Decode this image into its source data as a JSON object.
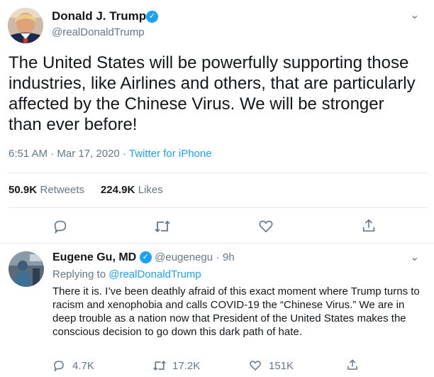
{
  "tweet": {
    "author_name": "Donald J. Trump",
    "author_handle": "@realDonaldTrump",
    "text": "The United States will be powerfully supporting those industries, like Airlines and others, that are particularly affected by the Chinese Virus. We will be stronger than ever before!",
    "time": "6:51 AM",
    "date": "Mar 17, 2020",
    "source": "Twitter for iPhone",
    "retweets_count": "50.9K",
    "retweets_label": "Retweets",
    "likes_count": "224.9K",
    "likes_label": "Likes",
    "icons": [
      "reply-icon",
      "retweet-icon",
      "like-icon",
      "share-icon"
    ]
  },
  "reply": {
    "author_name": "Eugene Gu, MD",
    "author_handle": "@eugenegu",
    "age": "9h",
    "replying_to_label": "Replying to",
    "replying_to_handle": "@realDonaldTrump",
    "text": "There it is. I’ve been deathly afraid of this exact moment where Trump turns to racism and xenophobia and calls COVID-19 the “Chinese Virus.” We are in deep trouble as a nation now that President of the United States makes the conscious decision to go down this dark path of hate.",
    "reply_count": "4.7K",
    "retweet_count": "17.2K",
    "like_count": "151K"
  },
  "colors": {
    "accent": "#1da1f2",
    "secondary_text": "#657786",
    "divider": "#e6ecf0"
  }
}
